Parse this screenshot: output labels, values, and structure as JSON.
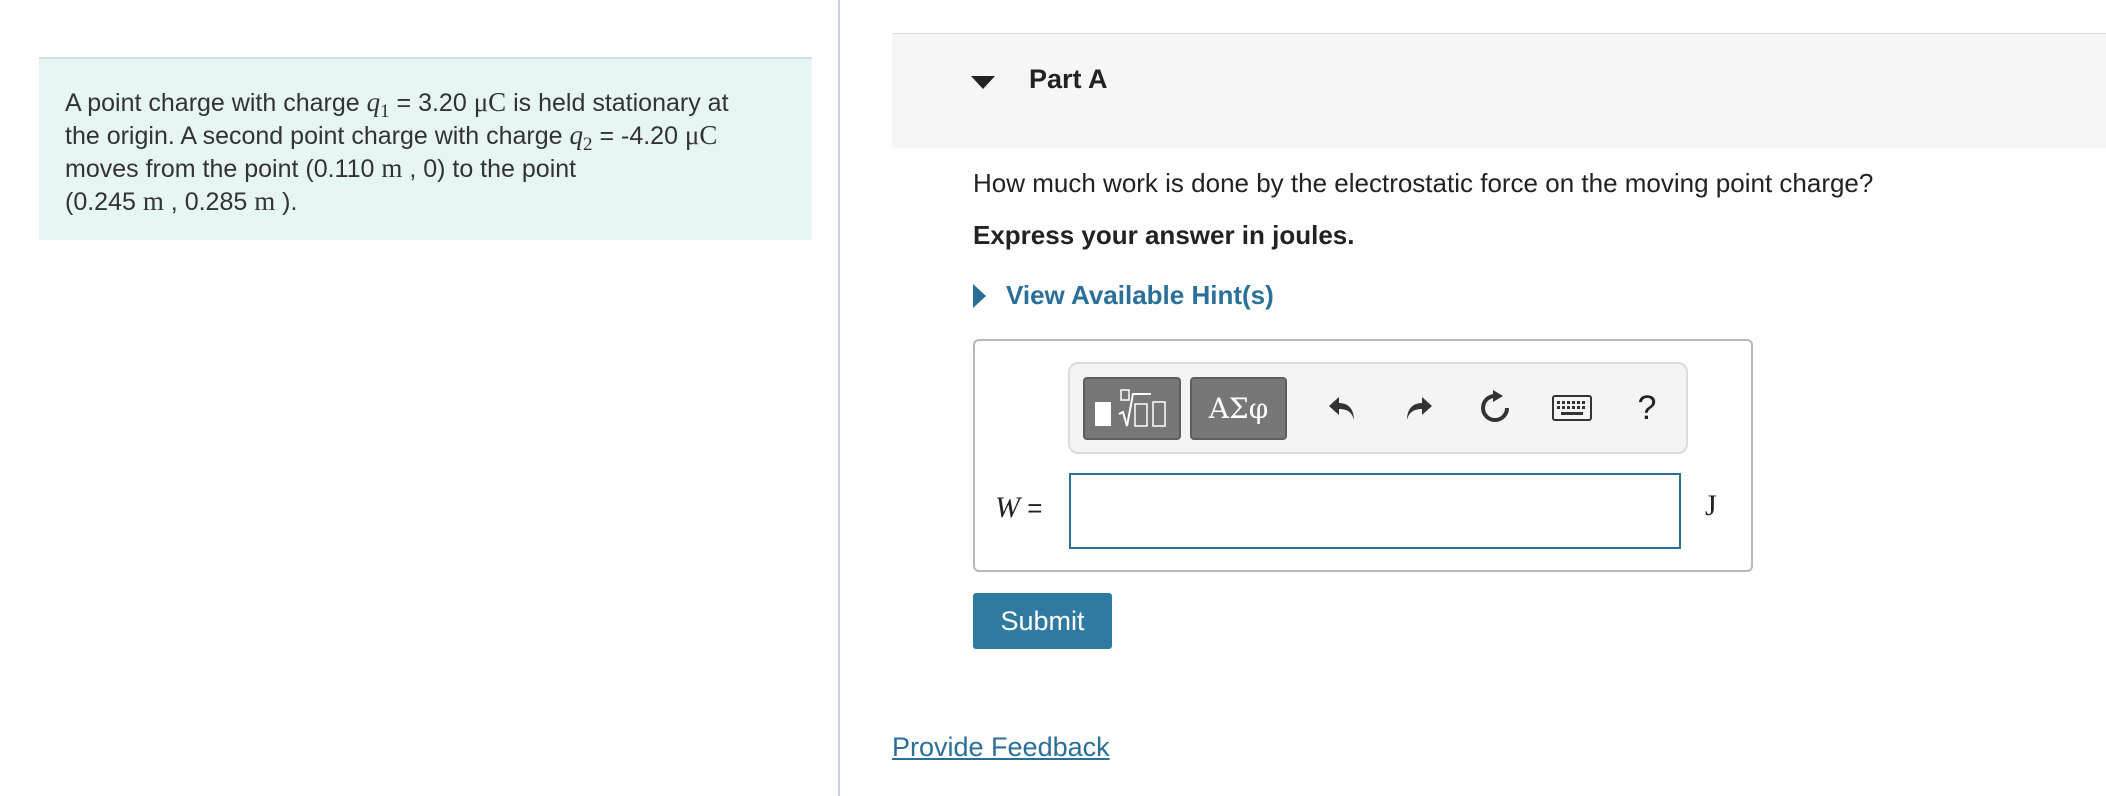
{
  "problem": {
    "line1_pre": "A point charge with charge ",
    "q1_symbol": "q",
    "q1_sub": "1",
    "q1_eq": " = 3.20 ",
    "q1_unit": "μC",
    "line1_post": " is held stationary at",
    "line2_pre": "the origin. A second point charge with charge ",
    "q2_symbol": "q",
    "q2_sub": "2",
    "q2_eq": " = -4.20 ",
    "q2_unit": "μC",
    "line3_pre": "moves from the point (0.110 ",
    "line3_unit": "m",
    "line3_post": " , 0) to the point",
    "line4_pre": "(0.245 ",
    "line4_unit1": "m",
    "line4_mid": " , 0.285 ",
    "line4_unit2": "m",
    "line4_post": " )."
  },
  "part": {
    "title": "Part A",
    "question": "How much work is done by the electrostatic force on the moving point charge?",
    "instruction": "Express your answer in joules.",
    "hints_label": "View Available Hint(s)"
  },
  "toolbar": {
    "greek_label": "ΑΣφ",
    "help_label": "?"
  },
  "answer": {
    "variable": "W",
    "equals": " =",
    "value": "",
    "unit": "J"
  },
  "submit_label": "Submit",
  "feedback_label": "Provide Feedback",
  "colors": {
    "problem_bg": "#e7f5f5",
    "accent": "#2a7098",
    "submit_bg": "#2f7aa0",
    "toolbar_btn": "#777777"
  },
  "icons": [
    "template-icon",
    "greek-symbols-icon",
    "undo-icon",
    "redo-icon",
    "reset-icon",
    "keyboard-icon",
    "help-icon"
  ]
}
